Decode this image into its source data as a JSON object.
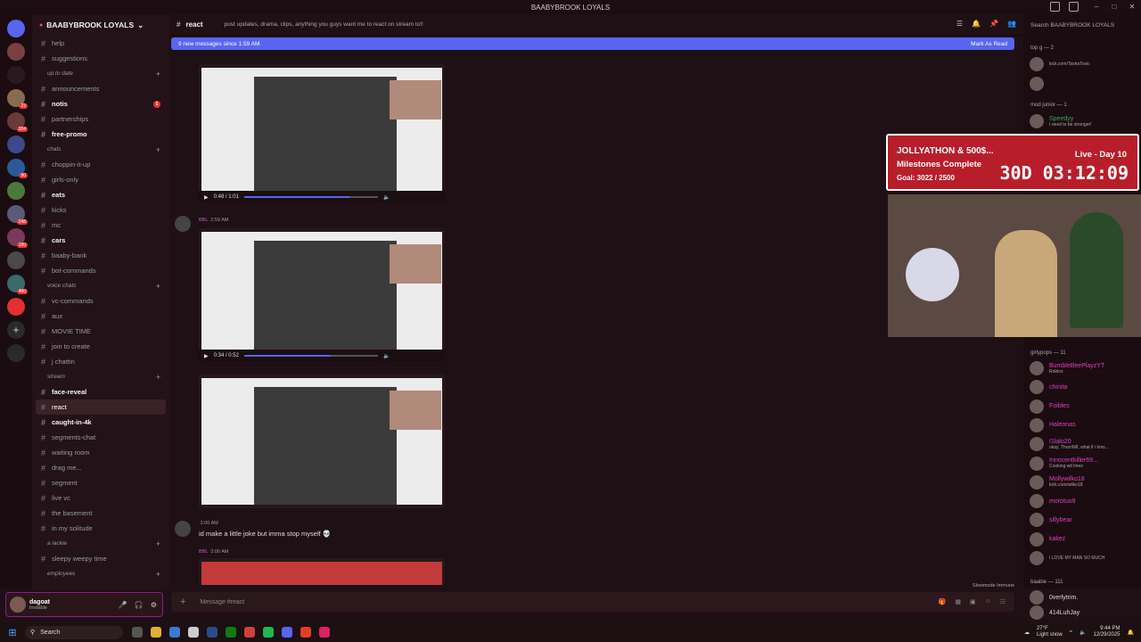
{
  "window": {
    "title": "BAABYBROOK LOYALS"
  },
  "server": {
    "name": "BAABYBROOK LOYALS"
  },
  "channels": [
    {
      "type": "ch",
      "label": "help"
    },
    {
      "type": "ch",
      "label": "suggestions"
    },
    {
      "type": "cat",
      "label": "up to date"
    },
    {
      "type": "ch",
      "label": "announcements"
    },
    {
      "type": "ch",
      "label": "notis",
      "unread": true,
      "badge": "1"
    },
    {
      "type": "ch",
      "label": "partnerships"
    },
    {
      "type": "ch",
      "label": "free-promo",
      "unread": true
    },
    {
      "type": "cat",
      "label": "chats"
    },
    {
      "type": "ch",
      "label": "choppin-it-up"
    },
    {
      "type": "ch",
      "label": "girls-only"
    },
    {
      "type": "ch",
      "label": "eats",
      "unread": true
    },
    {
      "type": "ch",
      "label": "kicks"
    },
    {
      "type": "ch",
      "label": "mc"
    },
    {
      "type": "ch",
      "label": "cars",
      "unread": true
    },
    {
      "type": "ch",
      "label": "baaby-bank"
    },
    {
      "type": "ch",
      "label": "bot-commands"
    },
    {
      "type": "cat",
      "label": "voice chats"
    },
    {
      "type": "ch",
      "label": "vc-commands"
    },
    {
      "type": "ch",
      "label": "aux"
    },
    {
      "type": "ch",
      "label": "MOVIE TIME"
    },
    {
      "type": "ch",
      "label": "join to create"
    },
    {
      "type": "ch",
      "label": "j chattin"
    },
    {
      "type": "cat",
      "label": "stream"
    },
    {
      "type": "ch",
      "label": "face-reveal",
      "unread": true
    },
    {
      "type": "ch",
      "label": "react",
      "active": true
    },
    {
      "type": "ch",
      "label": "caught-in-4k",
      "unread": true
    },
    {
      "type": "ch",
      "label": "segments-chat"
    },
    {
      "type": "ch",
      "label": "waiting room"
    },
    {
      "type": "ch",
      "label": "drag me..."
    },
    {
      "type": "ch",
      "label": "segment"
    },
    {
      "type": "ch",
      "label": "live vc"
    },
    {
      "type": "ch",
      "label": "the basement"
    },
    {
      "type": "ch",
      "label": "in my solitude"
    },
    {
      "type": "cat",
      "label": "a lackie"
    },
    {
      "type": "ch",
      "label": "sleepy weepy time"
    },
    {
      "type": "cat",
      "label": "employees"
    }
  ],
  "user": {
    "name": "dagoat",
    "status": "Invisible"
  },
  "channel_header": {
    "name": "react",
    "topic": "post updates, drama, clips, anything you guys want me to react on stream to!!"
  },
  "new_messages": {
    "text": "9 new messages since 1:59 AM",
    "action": "Mark As Read"
  },
  "videos": [
    {
      "time": "0:48 / 1:01",
      "progress": 0.79
    },
    {
      "time": "0:34 / 0:52",
      "progress": 0.65
    },
    {
      "time": "",
      "progress": 0.0
    }
  ],
  "messages": [
    {
      "author": "BBL",
      "time": "2:59 AM"
    },
    {
      "author": "",
      "time": "3:00 AM",
      "text": "id make a little joke but imma stop myself 💀"
    },
    {
      "author": "BBL",
      "time": "3:00 AM"
    }
  ],
  "composer": {
    "placeholder": "Message #react",
    "slowmode": "Slowmode Immune"
  },
  "search": {
    "placeholder": "Search BAABYBROOK LOYALS"
  },
  "members": {
    "groups": [
      {
        "label": "top g — 2"
      },
      {
        "label": "mod junior — 1"
      },
      {
        "label": "girlypops — 11"
      },
      {
        "label": "baabie — 111"
      }
    ],
    "top": [
      {
        "name": "",
        "sub": "kick.com/TashaToxic",
        "color": "#c060c0"
      },
      {
        "name": "",
        "sub": "",
        "color": "#c060c0"
      },
      {
        "name": "Speedyy",
        "sub": "I need to be stronger!",
        "color": "#3ba55d"
      }
    ],
    "girlypops": [
      {
        "name": "BumbleBeePlayzYT",
        "sub": "Roblox",
        "color": "#e040c0"
      },
      {
        "name": "chinita",
        "sub": "",
        "color": "#e040c0"
      },
      {
        "name": "Foibles",
        "sub": "",
        "color": "#e040c0"
      },
      {
        "name": "Haleonas",
        "sub": "",
        "color": "#e040c0"
      },
      {
        "name": "I1lalo20",
        "sub": "okay, ThornN8, what if i kms...",
        "color": "#e040c0"
      },
      {
        "name": "Innocentkiller69...",
        "sub": "Cooking wit lmeo",
        "color": "#e040c0"
      },
      {
        "name": "Mollywilko18",
        "sub": "kick.com/wilko18",
        "color": "#e040c0"
      },
      {
        "name": "morotuo9",
        "sub": "",
        "color": "#e040c0"
      },
      {
        "name": "sillybear",
        "sub": "",
        "color": "#e040c0"
      },
      {
        "name": "kakez",
        "sub": "",
        "color": "#e040c0"
      },
      {
        "name": "",
        "sub": "I LOVE MY MAN SO MUCH",
        "color": "#e040c0"
      }
    ],
    "baabie": [
      {
        "name": "0verlytrim.",
        "sub": "",
        "color": "#ddd"
      },
      {
        "name": "414LuhJay",
        "sub": "",
        "color": "#ddd"
      }
    ]
  },
  "stream_overlay": {
    "line1": "JOLLYATHON & 500$...",
    "line2": "Milestones Complete",
    "line3": "Goal: 3022 / 2500",
    "live": "Live - Day 10",
    "timer": "30D 03:12:09"
  },
  "taskbar": {
    "search": "Search",
    "weather_temp": "27°F",
    "weather": "Light snow",
    "time": "9:44 PM",
    "date": "12/29/2025"
  },
  "colors": {
    "accent": "#5865f2",
    "overlay": "#b81e2a",
    "member_pink": "#e040c0"
  }
}
